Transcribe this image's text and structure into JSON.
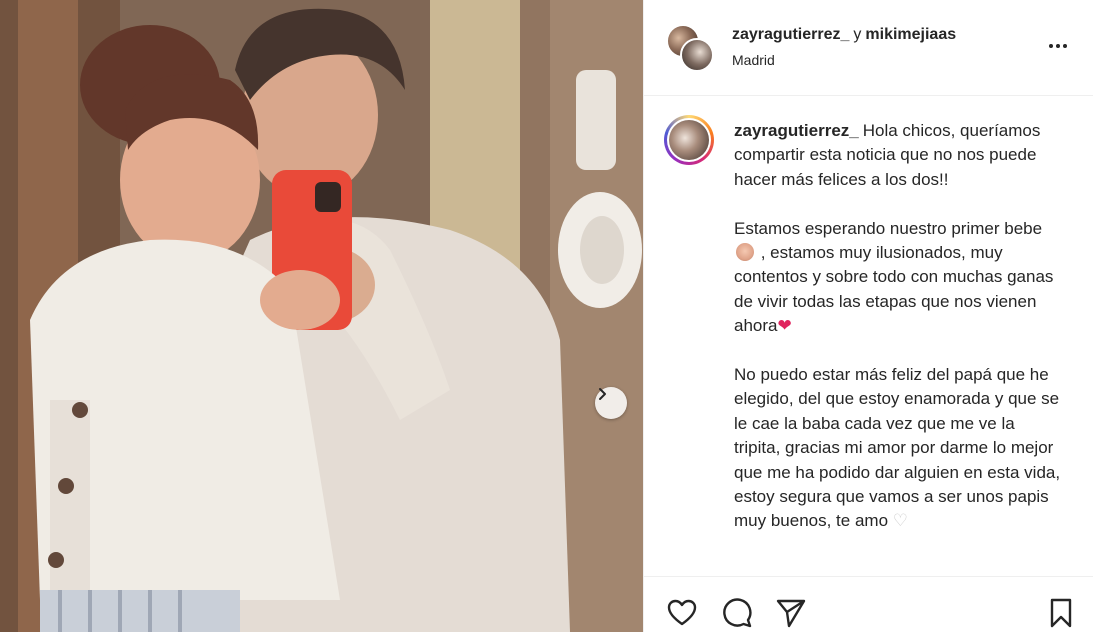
{
  "post": {
    "header": {
      "author": "zayragutierrez_",
      "conjunction": "y",
      "collaborator": "mikimejiaas",
      "location": "Madrid"
    },
    "caption": {
      "author": "zayragutierrez_",
      "paragraphs": [
        {
          "text": "Hola chicos, queríamos compartir esta noticia que no nos puede hacer más felices a los dos!!"
        },
        {
          "before": "Estamos esperando nuestro primer bebe",
          "after": " , estamos muy ilusionados, muy contentos y sobre todo con muchas ganas de vivir todas las etapas que nos vienen ahora",
          "emoji_end": "❤"
        },
        {
          "text": "No puedo estar más feliz del papá que he elegido, del que estoy enamorada y que se le cae la baba cada vez que me ve la tripita, gracias mi amor por darme lo mejor que me ha podido dar alguien en esta vida, estoy segura que vamos a ser unos papis muy buenos, te amo",
          "emoji_end": "♡"
        }
      ]
    },
    "icons": {
      "more": "more-horizontal-icon",
      "next": "chevron-right-icon",
      "like": "heart-outline-icon",
      "comment": "comment-bubble-icon",
      "share": "paper-plane-icon",
      "save": "bookmark-icon"
    },
    "colors": {
      "text": "#262626",
      "divider": "#efefef",
      "heart": "#e0245e"
    }
  }
}
